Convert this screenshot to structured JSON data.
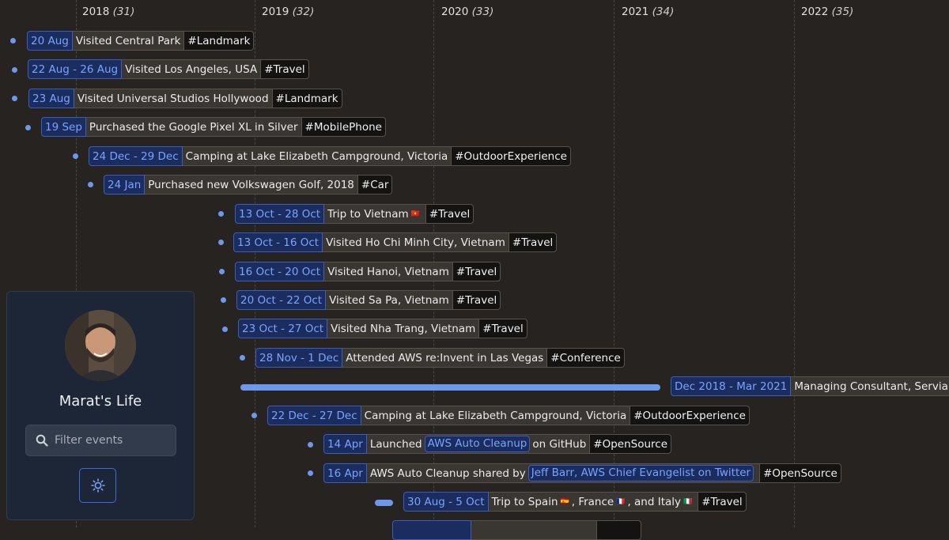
{
  "years": [
    {
      "label": "2018",
      "count": "(31)"
    },
    {
      "label": "2019",
      "count": "(32)"
    },
    {
      "label": "2020",
      "count": "(33)"
    },
    {
      "label": "2021",
      "count": "(34)"
    },
    {
      "label": "2022",
      "count": "(35)"
    }
  ],
  "events": [
    {
      "date": "20 Aug",
      "title": "Visited Central Park",
      "tag": "#Landmark"
    },
    {
      "date": "22 Aug - 26 Aug",
      "title": "Visited Los Angeles, USA",
      "tag": "#Travel"
    },
    {
      "date": "23 Aug",
      "title": "Visited Universal Studios Hollywood",
      "tag": "#Landmark"
    },
    {
      "date": "19 Sep",
      "title": "Purchased the Google Pixel XL in Silver",
      "tag": "#MobilePhone"
    },
    {
      "date": "24 Dec - 29 Dec",
      "title": "Camping at Lake Elizabeth Campground, Victoria",
      "tag": "#OutdoorExperience"
    },
    {
      "date": "24 Jan",
      "title": "Purchased new Volkswagen Golf, 2018",
      "tag": "#Car"
    },
    {
      "date": "13 Oct - 28 Oct",
      "title": "Trip to Vietnam",
      "flag": "🇻🇳",
      "tag": "#Travel"
    },
    {
      "date": "13 Oct - 16 Oct",
      "title": "Visited Ho Chi Minh City, Vietnam",
      "tag": "#Travel"
    },
    {
      "date": "16 Oct - 20 Oct",
      "title": "Visited Hanoi, Vietnam",
      "tag": "#Travel"
    },
    {
      "date": "20 Oct - 22 Oct",
      "title": "Visited Sa Pa, Vietnam",
      "tag": "#Travel"
    },
    {
      "date": "23 Oct - 27 Oct",
      "title": "Visited Nha Trang, Vietnam",
      "tag": "#Travel"
    },
    {
      "date": "28 Nov - 1 Dec",
      "title": "Attended AWS re:Invent in Las Vegas",
      "tag": "#Conference"
    },
    {
      "date": "Dec 2018 - Mar 2021",
      "title": "Managing Consultant, Servian",
      "tag": "#"
    },
    {
      "date": "22 Dec - 27 Dec",
      "title": "Camping at Lake Elizabeth Campground, Victoria",
      "tag": "#OutdoorExperience"
    },
    {
      "date": "14 Apr",
      "title_pre": "Launched",
      "link": "AWS Auto Cleanup",
      "title_post": "on GitHub",
      "tag": "#OpenSource"
    },
    {
      "date": "16 Apr",
      "title_pre": "AWS Auto Cleanup shared by",
      "link": "Jeff Barr, AWS Chief Evangelist on Twitter",
      "tag": "#OpenSource"
    },
    {
      "date": "30 Aug - 5 Oct",
      "title_pre": "Trip to Spain",
      "flag1": "🇪🇸",
      "mid1": ", France",
      "flag2": "🇫🇷",
      "mid2": ", and Italy",
      "flag3": "🇮🇹",
      "tag": "#Travel"
    }
  ],
  "sidebar": {
    "title": "Marat's Life",
    "search_placeholder": "Filter events"
  },
  "icons": {
    "search": "search-icon",
    "theme": "sun-icon",
    "avatar": "avatar"
  },
  "colors": {
    "background": "#272320",
    "accent": "#6e98ee",
    "date_bg": "#1b2d5e",
    "date_text": "#7aa2ff",
    "sidebar_bg": "#1d2636"
  }
}
